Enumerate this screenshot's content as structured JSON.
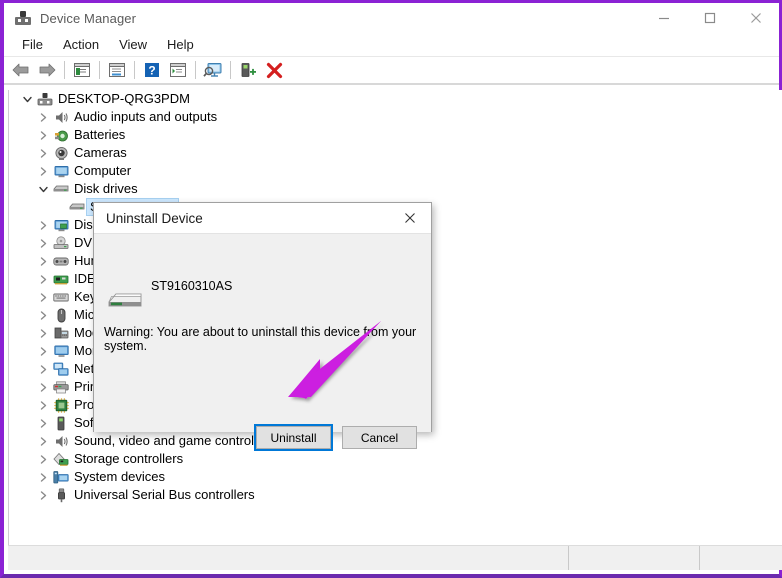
{
  "window": {
    "title": "Device Manager",
    "app_icon": "device-manager-icon",
    "border_color": "#8B22D4",
    "controls": [
      {
        "name": "minimize",
        "glyph": "minimize-icon"
      },
      {
        "name": "maximize",
        "glyph": "maximize-icon"
      },
      {
        "name": "close",
        "glyph": "close-icon"
      }
    ]
  },
  "menubar": {
    "items": [
      {
        "label": "File"
      },
      {
        "label": "Action"
      },
      {
        "label": "View"
      },
      {
        "label": "Help"
      }
    ]
  },
  "toolbar": {
    "buttons": [
      {
        "name": "back-button",
        "icon": "back-arrow-icon"
      },
      {
        "name": "forward-button",
        "icon": "forward-arrow-icon"
      },
      {
        "name": "properties-button",
        "icon": "properties-icon"
      },
      {
        "name": "show-hide-console-tree-button",
        "icon": "console-tree-icon"
      },
      {
        "name": "help-button",
        "icon": "help-question-icon"
      },
      {
        "name": "update-driver-button",
        "icon": "update-driver-icon"
      },
      {
        "name": "scan-hardware-changes-button",
        "icon": "scan-monitor-icon"
      },
      {
        "name": "add-legacy-hardware-button",
        "icon": "add-hardware-icon"
      },
      {
        "name": "uninstall-device-button",
        "icon": "red-x-icon"
      }
    ]
  },
  "tree": {
    "root": {
      "label": "DESKTOP-QRG3PDM",
      "icon": "computer-root-icon",
      "expanded": true
    },
    "items": [
      {
        "label": "Audio inputs and outputs",
        "icon": "speaker-icon",
        "expanded": false,
        "depth": 1
      },
      {
        "label": "Batteries",
        "icon": "battery-icon",
        "expanded": false,
        "depth": 1
      },
      {
        "label": "Cameras",
        "icon": "camera-icon",
        "expanded": false,
        "depth": 1
      },
      {
        "label": "Computer",
        "icon": "monitor-icon",
        "expanded": false,
        "depth": 1
      },
      {
        "label": "Disk drives",
        "icon": "disk-drive-icon",
        "expanded": true,
        "depth": 1
      },
      {
        "label": "ST9160310AS",
        "icon": "disk-drive-icon",
        "expanded": null,
        "depth": 2,
        "selected": true
      },
      {
        "label": "Display adapters",
        "icon": "display-adapter-icon",
        "expanded": false,
        "depth": 1
      },
      {
        "label": "DVD/CD-ROM drives",
        "icon": "dvd-drive-icon",
        "expanded": false,
        "depth": 1
      },
      {
        "label": "Human Interface Devices",
        "icon": "hid-icon",
        "expanded": false,
        "depth": 1
      },
      {
        "label": "IDE ATA/ATAPI controllers",
        "icon": "ide-controller-icon",
        "expanded": false,
        "depth": 1
      },
      {
        "label": "Keyboards",
        "icon": "keyboard-icon",
        "expanded": false,
        "depth": 1
      },
      {
        "label": "Mice and other pointing devices",
        "icon": "mouse-icon",
        "expanded": false,
        "depth": 1
      },
      {
        "label": "Modems",
        "icon": "modem-icon",
        "expanded": false,
        "depth": 1
      },
      {
        "label": "Monitors",
        "icon": "monitor-icon",
        "expanded": false,
        "depth": 1
      },
      {
        "label": "Network adapters",
        "icon": "network-adapter-icon",
        "expanded": false,
        "depth": 1
      },
      {
        "label": "Printers",
        "icon": "printer-icon",
        "expanded": false,
        "depth": 1
      },
      {
        "label": "Processors",
        "icon": "processor-icon",
        "expanded": false,
        "depth": 1
      },
      {
        "label": "Software devices",
        "icon": "software-device-icon",
        "expanded": false,
        "depth": 1
      },
      {
        "label": "Sound, video and game controllers",
        "icon": "speaker-icon",
        "expanded": false,
        "depth": 1
      },
      {
        "label": "Storage controllers",
        "icon": "storage-controller-icon",
        "expanded": false,
        "depth": 1
      },
      {
        "label": "System devices",
        "icon": "system-device-icon",
        "expanded": false,
        "depth": 1
      },
      {
        "label": "Universal Serial Bus controllers",
        "icon": "usb-controller-icon",
        "expanded": false,
        "depth": 1
      }
    ]
  },
  "dialog": {
    "title": "Uninstall Device",
    "close_label": "Close",
    "device_name": "ST9160310AS",
    "device_icon": "disk-drive-icon",
    "warning_text": "Warning: You are about to uninstall this device from your system.",
    "buttons": [
      {
        "label": "Uninstall",
        "name": "uninstall-button",
        "default": true
      },
      {
        "label": "Cancel",
        "name": "cancel-button",
        "default": false
      }
    ],
    "focus_outline_color": "#0078d7"
  },
  "annotation": {
    "arrow_color": "#cc1fe0",
    "points_to": "uninstall-button"
  },
  "statusbar": {
    "segments": [
      "",
      "",
      ""
    ]
  }
}
